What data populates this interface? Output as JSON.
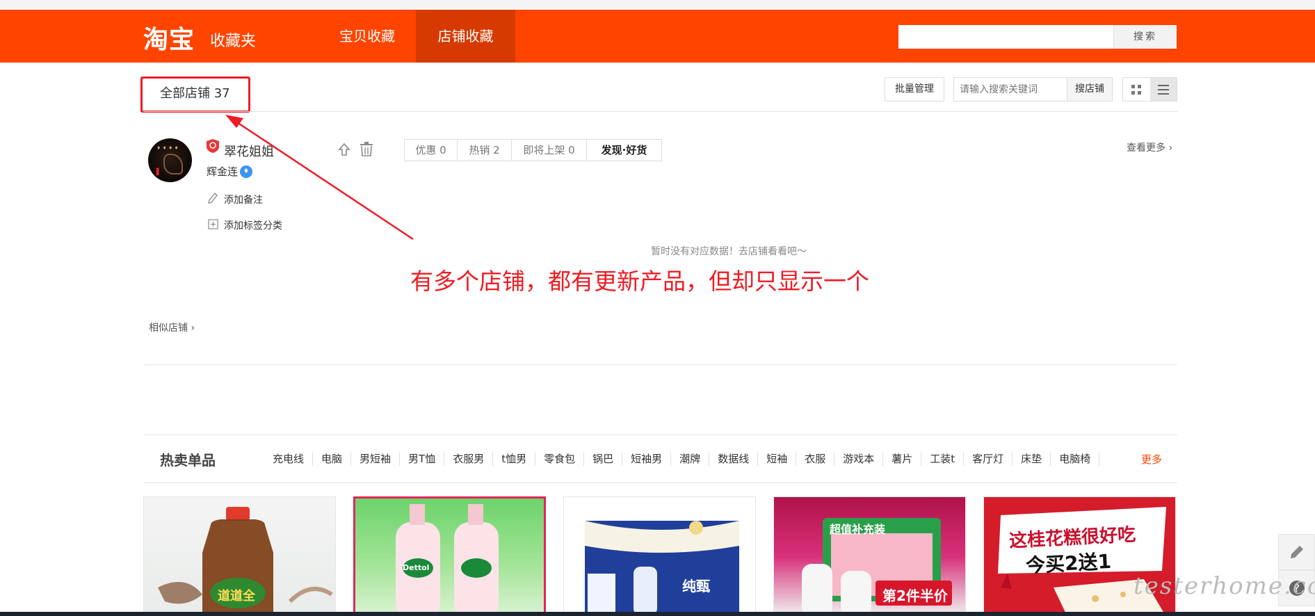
{
  "header": {
    "logo": "淘宝",
    "logo_sub": "收藏夹",
    "tabs": [
      {
        "label": "宝贝收藏",
        "active": false
      },
      {
        "label": "店铺收藏",
        "active": true
      }
    ],
    "search": {
      "placeholder": "",
      "button": "搜索"
    },
    "brand_color": "#ff4400"
  },
  "toolbar": {
    "all_shops": "全部店铺 37",
    "batch_manage": "批量管理",
    "shop_search_placeholder": "请输入搜索关键词",
    "shop_search_button": "搜店铺",
    "views": [
      "grid-icon",
      "list-icon"
    ],
    "active_view": "list"
  },
  "shop": {
    "name": "翠花姐姐",
    "owner": "辉金连",
    "add_note": "添加备注",
    "add_tag": "添加标签分类",
    "stats": [
      "优惠 0",
      "热销 2",
      "即将上架 0",
      "发现·好货"
    ],
    "see_more": "查看更多",
    "no_data": "暂时没有对应数据！去店铺看看吧～",
    "similar": "相似店铺"
  },
  "annotation": {
    "text": "有多个店铺，都有更新产品，但却只显示一个",
    "color": "#ee1c24"
  },
  "hot": {
    "title": "热卖单品",
    "items": [
      "充电线",
      "电脑",
      "男短袖",
      "男T恤",
      "衣服男",
      "t恤男",
      "零食包",
      "锅巴",
      "短袖男",
      "潮牌",
      "数据线",
      "短袖",
      "衣服",
      "游戏本",
      "薯片",
      "工装t",
      "客厅灯",
      "床垫",
      "电脑椅"
    ],
    "more": "更多"
  },
  "products": [
    {
      "label": "道道全"
    },
    {
      "label": "Dettol"
    },
    {
      "label": "纯甄"
    },
    {
      "top": "超值补充装",
      "label": "第2件半价"
    },
    {
      "line1": "这桂花糕很好吃",
      "line2": "今买2送1"
    }
  ],
  "watermark": "testerhome.com"
}
